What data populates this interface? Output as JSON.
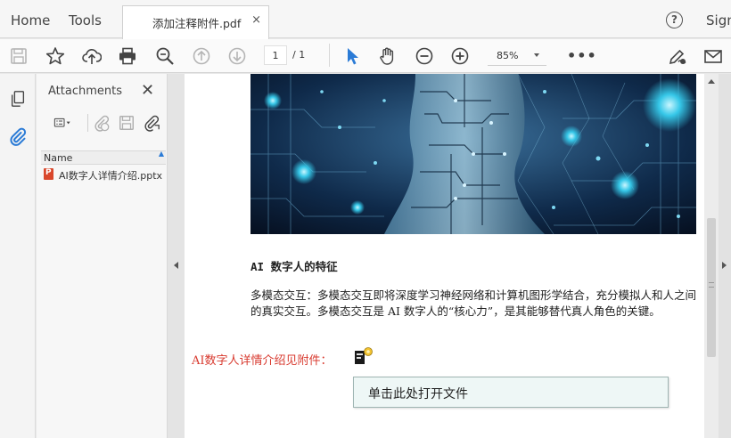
{
  "colors": {
    "accent_blue": "#2b7bd6",
    "link_red": "#d83a2f",
    "tooltip_bg": "#eef7f6"
  },
  "menu": {
    "home": "Home",
    "tools": "Tools",
    "sign_in": "Sign"
  },
  "tab": {
    "title": "添加注释附件.pdf",
    "close_glyph": "×"
  },
  "help": {
    "glyph": "?",
    "icon": "help-icon"
  },
  "toolbar": {
    "icons": [
      "save-icon",
      "bookmark-star-icon",
      "upload-cloud-icon",
      "print-icon",
      "zoom-search-icon",
      "page-up-icon",
      "page-down-icon",
      "select-arrow-icon",
      "hand-icon",
      "zoom-out-icon",
      "zoom-in-icon",
      "more-icon",
      "sign-pen-icon",
      "mail-icon"
    ],
    "page_current": "1",
    "page_total": "/ 1",
    "zoom": "85%",
    "more": "•••"
  },
  "left_rail": {
    "items": [
      "page-thumbnails-icon",
      "attachments-paperclip-icon"
    ]
  },
  "attachments": {
    "title": "Attachments",
    "close_glyph": "✕",
    "tools": [
      "options-menu-icon",
      "add-attachment-icon",
      "save-attachment-icon",
      "open-attachment-icon"
    ],
    "column_name": "Name",
    "files": [
      {
        "name": "AI数字人详情介绍.pptx",
        "icon": "pptx-file-icon"
      }
    ]
  },
  "document": {
    "heading": "AI 数字人的特征",
    "paragraph": "多模态交互：多模态交互即将深度学习神经网络和计算机图形学结合，充分模拟人和人之间的真实交互。多模态交互是 AI 数字人的“核心力”，是其能够替代真人角色的关键。",
    "link_text": "AI数字人详情介绍见附件：",
    "tooltip": "单击此处打开文件"
  }
}
